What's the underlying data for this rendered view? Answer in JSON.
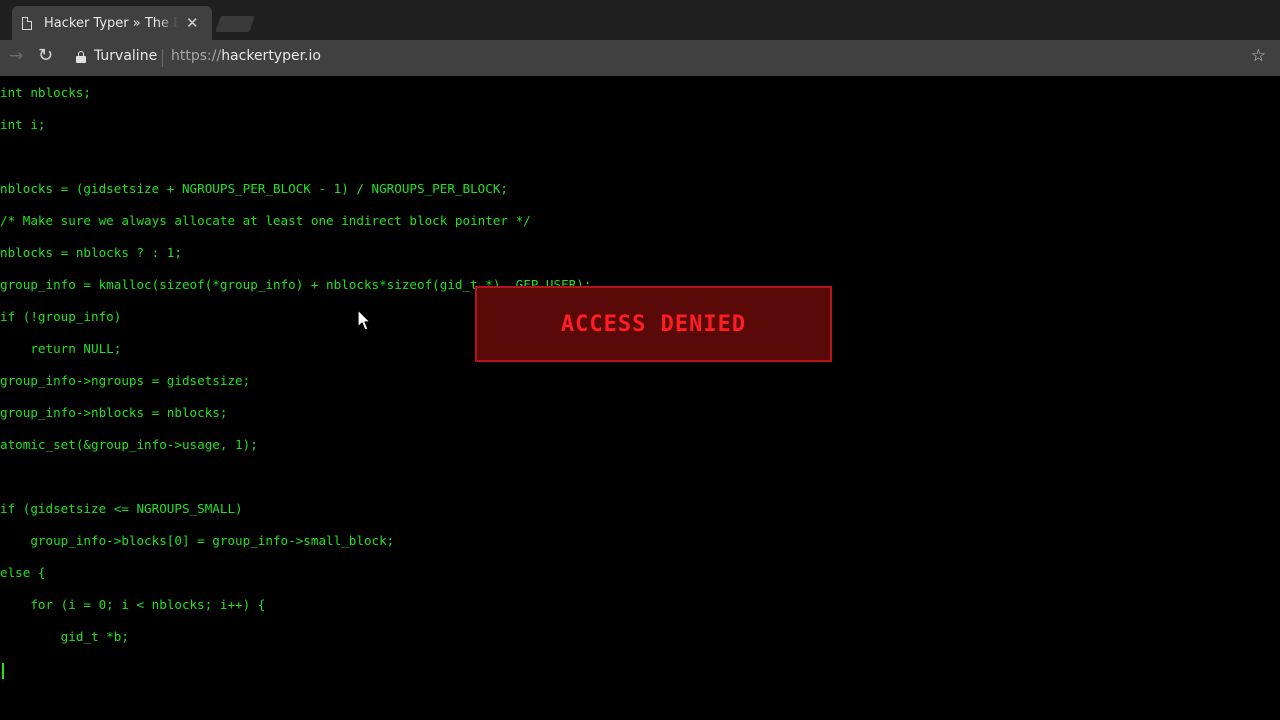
{
  "browser": {
    "tab": {
      "title": "Hacker Typer » The Best",
      "icon": "page-icon",
      "close_icon": "close-icon"
    },
    "toolbar": {
      "forward_icon": "arrow-right-icon",
      "reload_icon": "reload-icon",
      "security_icon": "lock-icon",
      "site_name": "Turvaline",
      "url_scheme": "https://",
      "url_host": "hackertyper.io",
      "bookmark_icon": "star-icon"
    }
  },
  "terminal": {
    "lines": [
      "int nblocks;",
      "int i;",
      "",
      "nblocks = (gidsetsize + NGROUPS_PER_BLOCK - 1) / NGROUPS_PER_BLOCK;",
      "/* Make sure we always allocate at least one indirect block pointer */",
      "nblocks = nblocks ? : 1;",
      "group_info = kmalloc(sizeof(*group_info) + nblocks*sizeof(gid_t *), GFP_USER);",
      "if (!group_info)",
      "    return NULL;",
      "group_info->ngroups = gidsetsize;",
      "group_info->nblocks = nblocks;",
      "atomic_set(&group_info->usage, 1);",
      "",
      "if (gidsetsize <= NGROUPS_SMALL)",
      "    group_info->blocks[0] = group_info->small_block;",
      "else {",
      "    for (i = 0; i < nblocks; i++) {",
      "        gid_t *b;"
    ],
    "text_color": "#21e021"
  },
  "alert": {
    "text": "ACCESS DENIED",
    "text_color": "#ff1d24",
    "background_color": "#5a0909"
  }
}
